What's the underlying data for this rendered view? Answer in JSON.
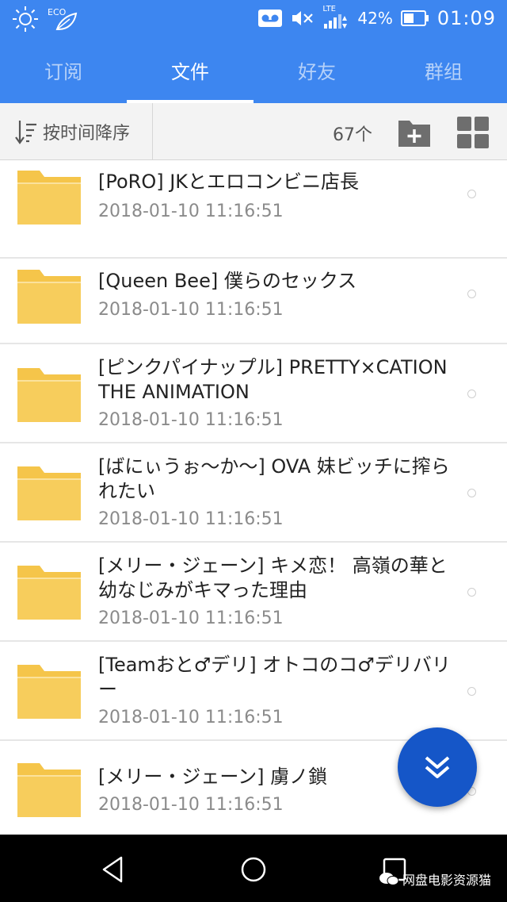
{
  "status_bar": {
    "eco_label": "ECO",
    "battery": "42%",
    "time": "01:09",
    "network": "LTE"
  },
  "tabs": [
    {
      "label": "订阅",
      "active": false
    },
    {
      "label": "文件",
      "active": true
    },
    {
      "label": "好友",
      "active": false
    },
    {
      "label": "群组",
      "active": false
    }
  ],
  "toolbar": {
    "sort_label": "按时间降序",
    "count": "67个"
  },
  "files": [
    {
      "title": "[PoRO] JKとエロコンビニ店長",
      "date": "2018-01-10 11:16:51"
    },
    {
      "title": "[Queen Bee] 僕らのセックス",
      "date": "2018-01-10 11:16:51"
    },
    {
      "title": "[ピンクパイナップル] PRETTY×CATION THE ANIMATION",
      "date": "2018-01-10 11:16:51"
    },
    {
      "title": "[ばにぃうぉ～か～] OVA 妹ビッチに搾られたい",
      "date": "2018-01-10 11:16:51"
    },
    {
      "title": "[メリー・ジェーン] キメ恋！ 高嶺の華と幼なじみがキマった理由",
      "date": "2018-01-10 11:16:51"
    },
    {
      "title": "[Teamおと♂デリ] オトコのコ♂デリバリー",
      "date": "2018-01-10 11:16:51"
    },
    {
      "title": "[メリー・ジェーン] 虜ノ鎖",
      "date": "2018-01-10 11:16:51"
    }
  ],
  "watermark": "网盘电影资源猫",
  "colors": {
    "header": "#3d86f0",
    "fab": "#1556c8",
    "folder": "#f5c54a"
  }
}
